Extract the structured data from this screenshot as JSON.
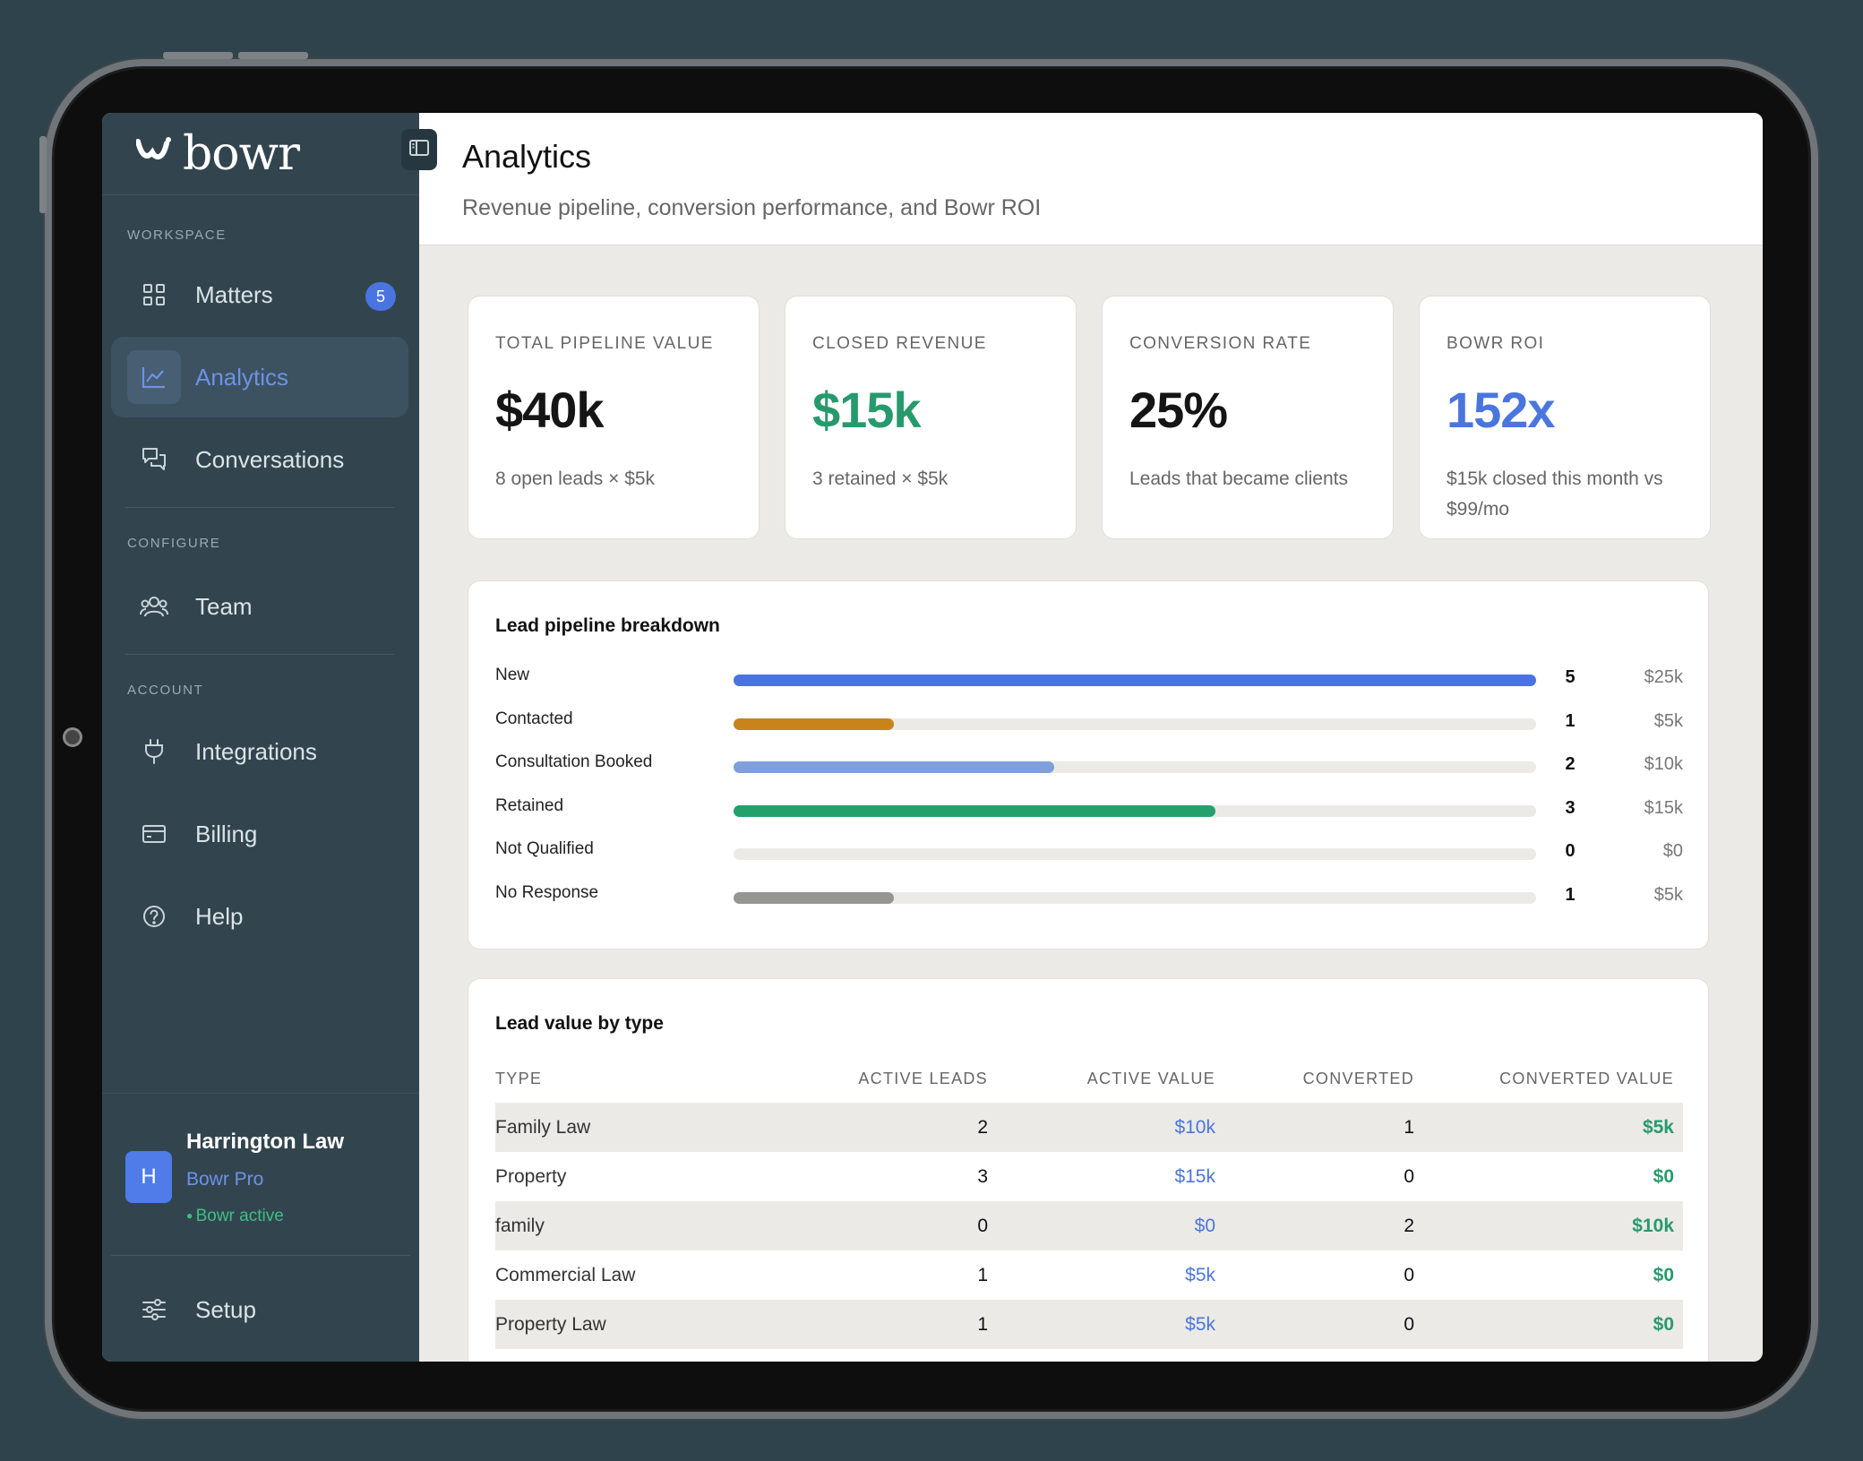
{
  "app": {
    "brand": "bowr"
  },
  "sidebar": {
    "sections": {
      "workspace": "WORKSPACE",
      "configure": "CONFIGURE",
      "account": "ACCOUNT"
    },
    "items": [
      {
        "label": "Matters",
        "icon": "grid-icon",
        "badge": "5"
      },
      {
        "label": "Analytics",
        "icon": "chart-line-icon",
        "active": true
      },
      {
        "label": "Conversations",
        "icon": "chat-icon"
      },
      {
        "label": "Team",
        "icon": "users-icon"
      },
      {
        "label": "Integrations",
        "icon": "plug-icon"
      },
      {
        "label": "Billing",
        "icon": "credit-card-icon"
      },
      {
        "label": "Help",
        "icon": "help-circle-icon"
      }
    ],
    "account": {
      "avatar": "H",
      "name": "Harrington Law",
      "plan": "Bowr Pro",
      "status": "Bowr active"
    },
    "setup": {
      "label": "Setup",
      "icon": "sliders-icon"
    }
  },
  "header": {
    "title": "Analytics",
    "subtitle": "Revenue pipeline, conversion performance, and Bowr ROI"
  },
  "cards": [
    {
      "label": "TOTAL PIPELINE VALUE",
      "value": "$40k",
      "sub": "8 open leads × $5k"
    },
    {
      "label": "CLOSED REVENUE",
      "value": "$15k",
      "sub": "3 retained × $5k"
    },
    {
      "label": "CONVERSION RATE",
      "value": "25%",
      "sub": "Leads that became clients"
    },
    {
      "label": "BOWR ROI",
      "value": "152x",
      "sub": "$15k closed this month vs $99/mo"
    }
  ],
  "pipeline": {
    "title": "Lead pipeline breakdown",
    "rows": [
      {
        "label": "New",
        "count": "5",
        "value": "$25k",
        "fraction": 1.0,
        "color": "#4a72e0"
      },
      {
        "label": "Contacted",
        "count": "1",
        "value": "$5k",
        "fraction": 0.2,
        "color": "#c8841a"
      },
      {
        "label": "Consultation Booked",
        "count": "2",
        "value": "$10k",
        "fraction": 0.4,
        "color": "#7f9fdc"
      },
      {
        "label": "Retained",
        "count": "3",
        "value": "$15k",
        "fraction": 0.6,
        "color": "#24a06c"
      },
      {
        "label": "Not Qualified",
        "count": "0",
        "value": "$0",
        "fraction": 0,
        "color": "#9a9a96"
      },
      {
        "label": "No Response",
        "count": "1",
        "value": "$5k",
        "fraction": 0.2,
        "color": "#959591"
      }
    ]
  },
  "lead_table": {
    "title": "Lead value by type",
    "headers": [
      "TYPE",
      "ACTIVE LEADS",
      "ACTIVE VALUE",
      "CONVERTED",
      "CONVERTED VALUE"
    ],
    "rows": [
      [
        "Family Law",
        "2",
        "$10k",
        "1",
        "$5k"
      ],
      [
        "Property",
        "3",
        "$15k",
        "0",
        "$0"
      ],
      [
        "family",
        "0",
        "$0",
        "2",
        "$10k"
      ],
      [
        "Commercial Law",
        "1",
        "$5k",
        "0",
        "$0"
      ],
      [
        "Property Law",
        "1",
        "$5k",
        "0",
        "$0"
      ]
    ]
  }
}
